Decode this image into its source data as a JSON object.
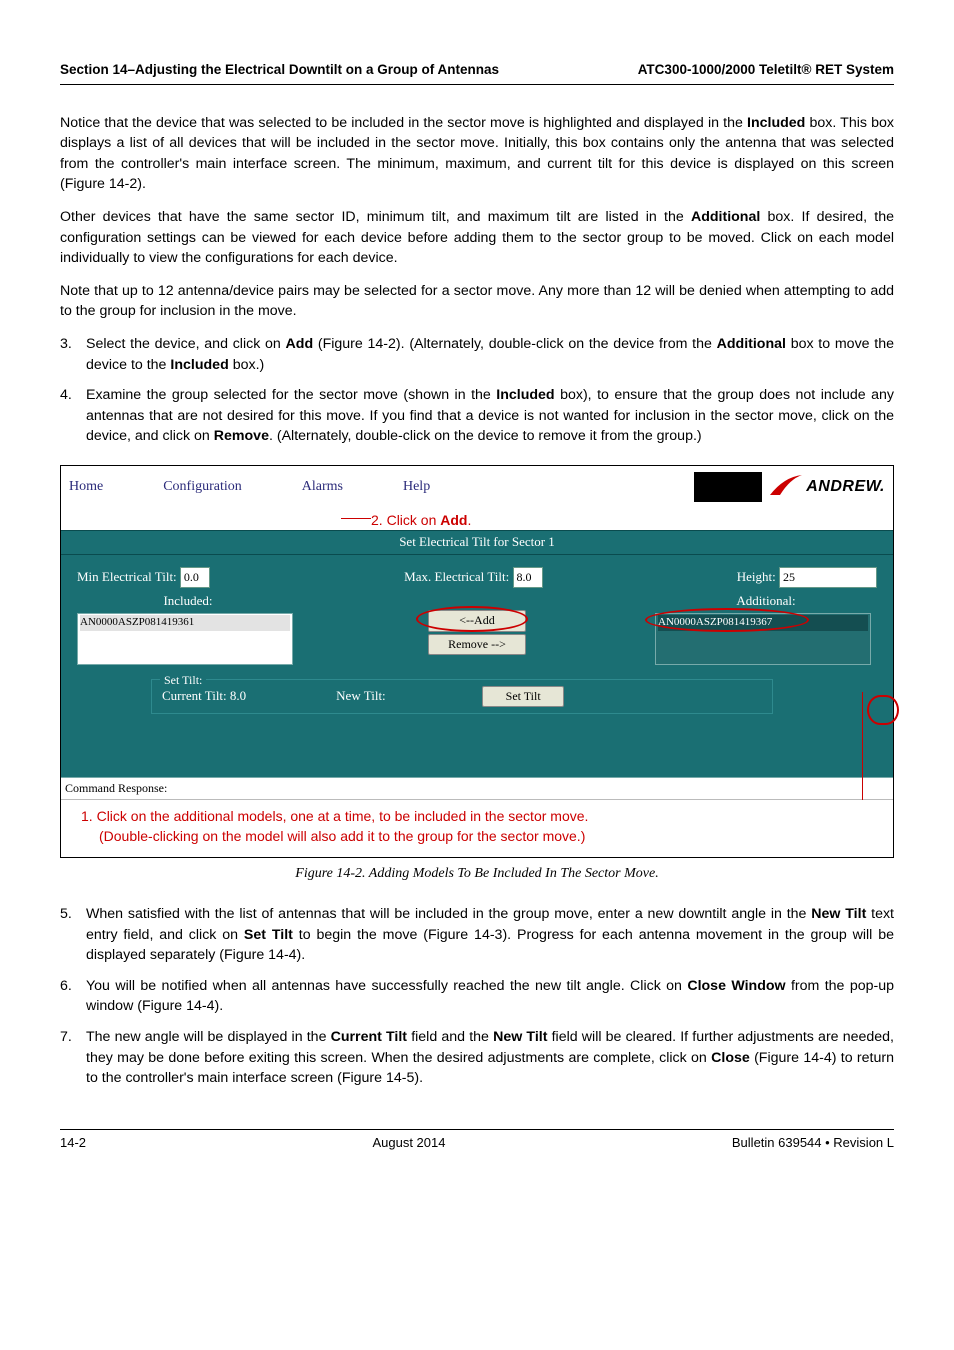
{
  "header": {
    "left": "Section 14–Adjusting the Electrical Downtilt on a Group of Antennas",
    "right": "ATC300-1000/2000 Teletilt® RET System"
  },
  "p1": "Notice that the device that was selected to be included in the sector move is highlighted and displayed in the ",
  "p1b": "Included",
  "p1c": " box. This box displays a list of all devices that will be included in the sector move. Initially, this box contains only the antenna that was selected from the controller's main interface screen. The minimum, maximum, and current tilt for this device is displayed on this screen (Figure 14-2).",
  "p2a": "Other devices that have the same sector ID, minimum tilt, and maximum tilt are listed in the ",
  "p2b": "Additional",
  "p2c": " box. If desired, the configuration settings can be viewed for each device before adding them to the sector group to be moved. Click on each model individually to view the configurations for each device.",
  "p3": "Note that up to 12 antenna/device pairs may be selected for a sector move. Any more than 12 will be denied when attempting to add to the group for inclusion in the move.",
  "li3_a": "Select the device, and click on ",
  "li3_add": "Add",
  "li3_b": " (Figure 14-2). (Alternately, double-click on the device from the ",
  "li3_c": "Additional",
  "li3_d": " box to move the device to the ",
  "li3_e": "Included",
  "li3_f": " box.)",
  "li4_a": "Examine the group selected for the sector move (shown in the ",
  "li4_b": "Included",
  "li4_c": " box), to ensure that the group does not include any antennas that are not desired for this move. If you find that a device is not wanted for inclusion in the sector move, click on the device, and click on ",
  "li4_d": "Remove",
  "li4_e": ". (Alternately, double-click on the device to remove it from the group.)",
  "menubar": {
    "home": "Home",
    "config": "Configuration",
    "alarms": "Alarms",
    "help": "Help"
  },
  "logo_text": "ANDREW.",
  "callout2_num": "2.",
  "callout2_txt": "  Click on ",
  "callout2_b": "Add",
  "callout2_dot": ".",
  "teal_title": "Set Electrical Tilt for Sector 1",
  "min_label": "Min Electrical Tilt: ",
  "min_val": "0.0",
  "max_label": "Max. Electrical Tilt: ",
  "max_val": "8.0",
  "height_label": "Height: ",
  "height_val": "25",
  "included_label": "Included:",
  "included_item": "AN0000ASZP081419361",
  "additional_label": "Additional:",
  "additional_item": "AN0000ASZP081419367",
  "btn_add": "<--Add",
  "btn_remove": "Remove -->",
  "set_tilt_legend": "Set Tilt:",
  "current_tilt_label": "Current Tilt: ",
  "current_tilt_val": "8.0",
  "new_tilt_label": "New Tilt:",
  "set_tilt_btn": "Set Tilt",
  "cmd_resp": "Command Response:",
  "callout1_num": "1.",
  "callout1_line1": "  Click on the additional models, one at a time, to be included in the sector move.",
  "callout1_line2": "(Double-clicking on the model will also add it to the group for the sector move.)",
  "fig_caption": "Figure 14-2.  Adding Models To Be Included In The Sector Move.",
  "li5_a": "When satisfied with the list of antennas that will be included in the group move, enter a new downtilt angle in the ",
  "li5_b": "New Tilt",
  "li5_c": " text entry field, and click on ",
  "li5_d": "Set Tilt",
  "li5_e": " to begin the move (Figure 14-3). Progress for each antenna movement in the group will be displayed separately (Figure 14-4).",
  "li6_a": "You will be notified when all antennas have successfully reached the new tilt angle. Click on ",
  "li6_b": "Close Window",
  "li6_c": " from the pop-up window (Figure 14-4).",
  "li7_a": "The new angle will be displayed in the ",
  "li7_b": "Current Tilt",
  "li7_c": " field and the ",
  "li7_d": "New Tilt",
  "li7_e": " field will be cleared. If further adjustments are needed, they may be done before exiting this screen. When the desired adjustments are complete, click on ",
  "li7_f": "Close",
  "li7_g": " (Figure 14-4) to return to the controller's main interface screen (Figure 14-5).",
  "footer": {
    "left": "14-2",
    "center": "August 2014",
    "right": "Bulletin 639544  •  Revision L"
  }
}
